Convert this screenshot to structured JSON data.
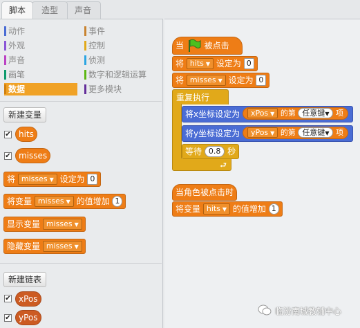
{
  "tabs": [
    {
      "label": "脚本",
      "active": true
    },
    {
      "label": "造型",
      "active": false
    },
    {
      "label": "声音",
      "active": false
    }
  ],
  "categories_left": [
    {
      "label": "动作",
      "color": "#4a6cd4"
    },
    {
      "label": "外观",
      "color": "#8a55d7"
    },
    {
      "label": "声音",
      "color": "#bb42c3"
    },
    {
      "label": "画笔",
      "color": "#0e9a6c"
    },
    {
      "label": "数据",
      "color": "#ee7d16",
      "selected": true
    }
  ],
  "categories_right": [
    {
      "label": "事件",
      "color": "#c88330"
    },
    {
      "label": "控制",
      "color": "#e1a91a"
    },
    {
      "label": "侦测",
      "color": "#2ca5e2"
    },
    {
      "label": "数字和逻辑运算",
      "color": "#5cb712"
    },
    {
      "label": "更多模块",
      "color": "#632d99"
    }
  ],
  "palette": {
    "new_var_button": "新建变量",
    "variables": [
      "hits",
      "misses"
    ],
    "set_block": {
      "text1": "将",
      "var": "misses",
      "text2": "设定为",
      "value": "0"
    },
    "change_block": {
      "text1": "将变量",
      "var": "misses",
      "text2": "的值增加",
      "value": "1"
    },
    "show_block": {
      "text1": "显示变量",
      "var": "misses"
    },
    "hide_block": {
      "text1": "隐藏变量",
      "var": "misses"
    },
    "new_list_button": "新建链表",
    "lists": [
      "xPos",
      "yPos"
    ]
  },
  "script1": {
    "hat": {
      "text1": "当",
      "flag_icon": "green-flag",
      "text2": "被点击"
    },
    "set_hits": {
      "text1": "将",
      "var": "hits",
      "text2": "设定为",
      "value": "0"
    },
    "set_misses": {
      "text1": "将",
      "var": "misses",
      "text2": "设定为",
      "value": "0"
    },
    "forever": "重复执行",
    "set_x": {
      "text1": "将x坐标设定为",
      "list": "xPos",
      "text2": "的第",
      "item": "任意键",
      "text3": "项"
    },
    "set_y": {
      "text1": "将y坐标设定为",
      "list": "yPos",
      "text2": "的第",
      "item": "任意键",
      "text3": "项"
    },
    "wait": {
      "text1": "等待",
      "value": "0.8",
      "text2": "秒"
    }
  },
  "script2": {
    "hat": "当角色被点击时",
    "change": {
      "text1": "将变量",
      "var": "hits",
      "text2": "的值增加",
      "value": "1"
    }
  },
  "watermark": "临汾南城教辅中心"
}
